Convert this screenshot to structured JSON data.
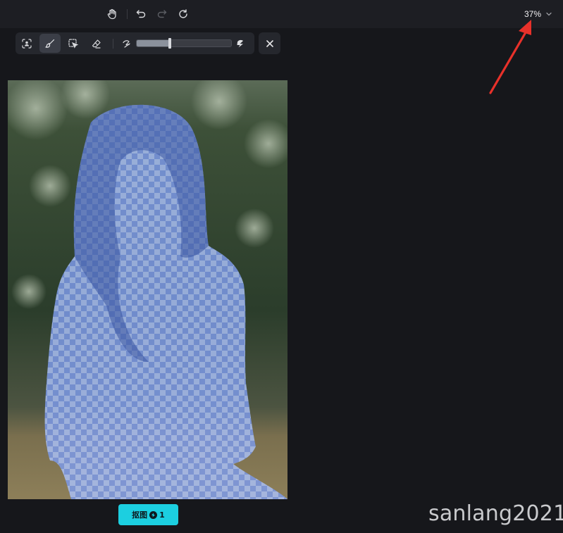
{
  "topbar": {
    "icons": [
      "hand-icon",
      "undo-icon",
      "redo-icon",
      "refresh-icon"
    ],
    "zoom": {
      "value": "37%",
      "icon": "chevron-down-icon"
    }
  },
  "toolbar": {
    "tools": [
      "person-select-icon",
      "brush-icon",
      "smart-select-icon",
      "eraser-icon"
    ],
    "active_tool": "brush-icon",
    "brush_size": {
      "min_icon": "small-brush-icon",
      "max_icon": "large-brush-icon",
      "level": 0.35
    },
    "close_icon": "close-icon"
  },
  "canvas": {
    "image": "portrait of a woman with a blue semi-transparent selection mask"
  },
  "action": {
    "label": "抠图",
    "count": "1",
    "accent": "#1ccfe0"
  },
  "annotation": {
    "color": "#e8312a"
  },
  "watermark": "sanlang2021"
}
